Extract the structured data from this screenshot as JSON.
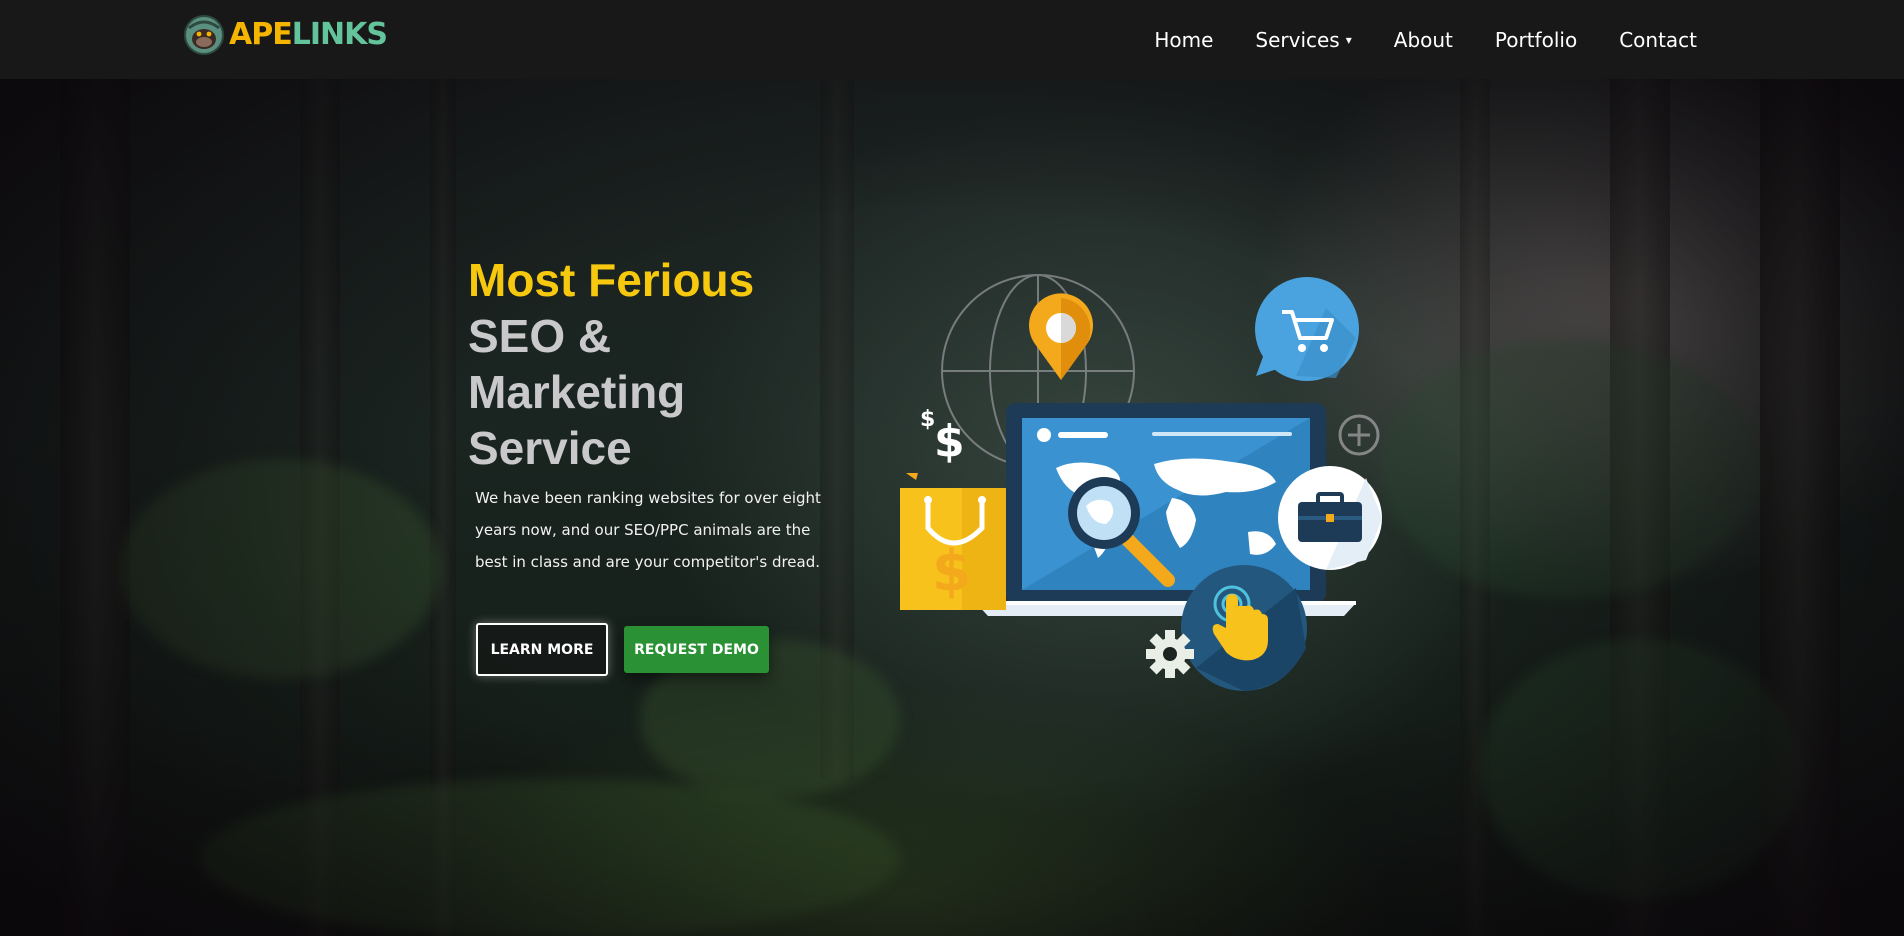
{
  "brand": {
    "logo_part1": "APE",
    "logo_part2": "LINKS"
  },
  "nav": {
    "items": [
      {
        "label": "Home"
      },
      {
        "label": "Services",
        "has_dropdown": true
      },
      {
        "label": "About"
      },
      {
        "label": "Portfolio"
      },
      {
        "label": "Contact"
      }
    ],
    "dropdown_caret": "▾"
  },
  "hero": {
    "headline_accent": "Most Ferious",
    "headline_line2": "SEO &",
    "headline_line3": "Marketing",
    "headline_line4": "Service",
    "description": "We have been ranking websites for over eight years now, and our SEO/PPC animals are the best in class and are your competitor's dread.",
    "learn_more_label": "LEARN MORE",
    "request_demo_label": "REQUEST DEMO"
  },
  "illustration": {
    "icons": [
      "globe-icon",
      "location-pin-icon",
      "shopping-cart-icon",
      "dollar-sign-icon",
      "shopping-bag-icon",
      "laptop-world-map-icon",
      "magnifying-glass-icon",
      "briefcase-icon",
      "touch-hand-icon",
      "gear-icon",
      "plus-icon"
    ],
    "dollar_small": "$",
    "dollar_large": "$",
    "bag_dollar": "$"
  },
  "colors": {
    "navbar_bg": "#181818",
    "accent_yellow": "#f6c90e",
    "headline_gray": "#c9c9cb",
    "demo_green": "#2a9134",
    "logo_orange": "#f4b400",
    "logo_green": "#63c39a"
  }
}
